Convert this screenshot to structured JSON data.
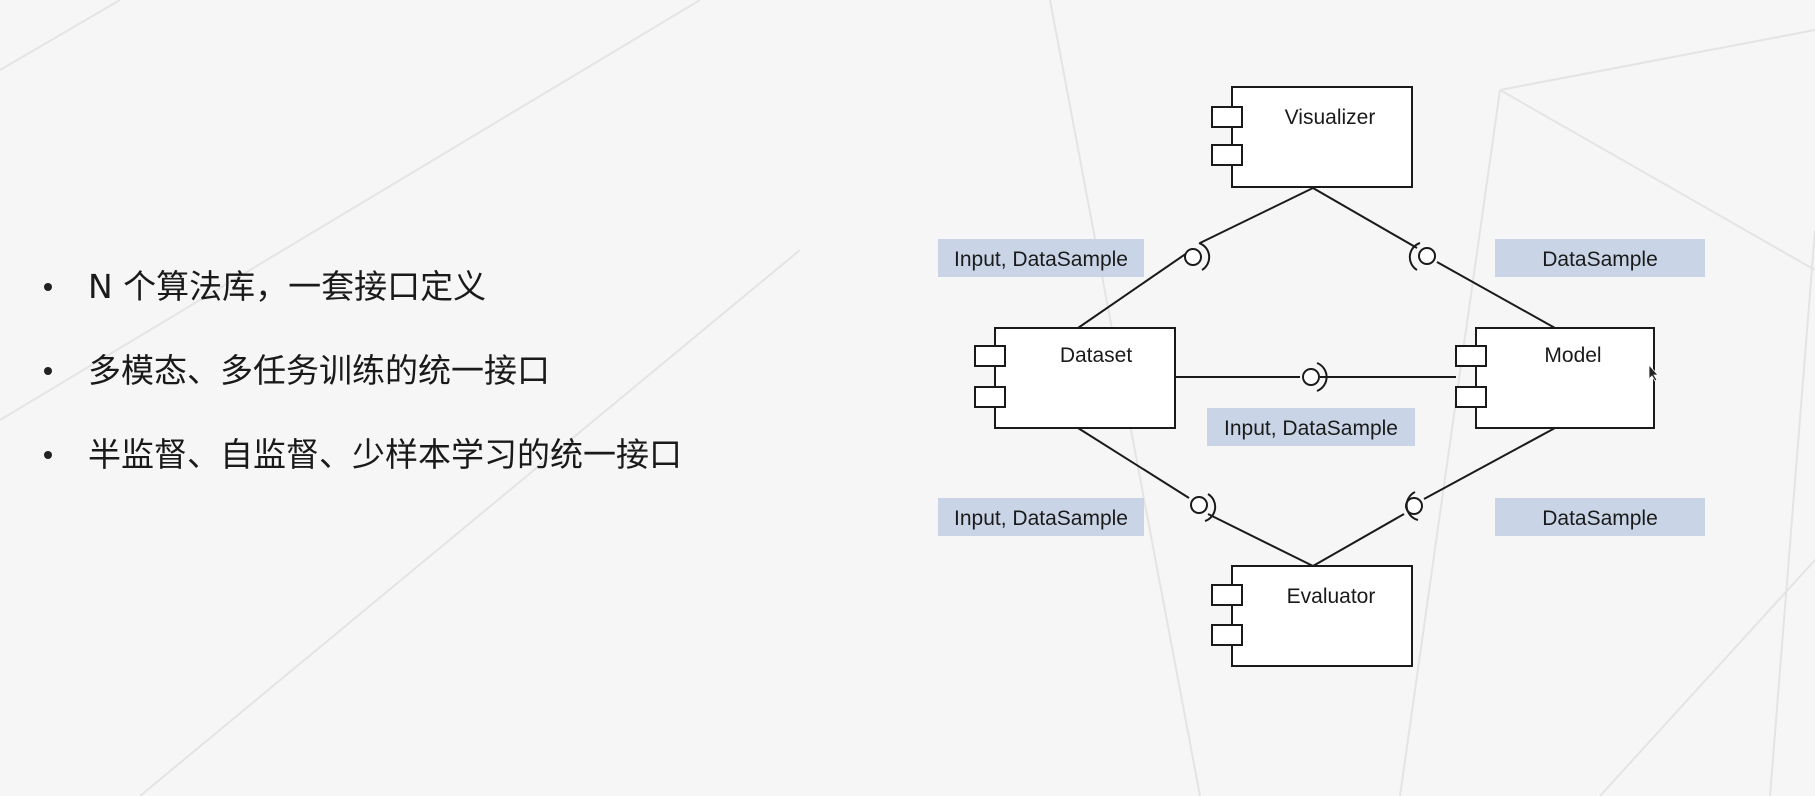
{
  "bullets": [
    "N 个算法库，一套接口定义",
    "多模态、多任务训练的统一接口",
    "半监督、自监督、少样本学习的统一接口"
  ],
  "components": {
    "visualizer": "Visualizer",
    "dataset": "Dataset",
    "model": "Model",
    "evaluator": "Evaluator"
  },
  "interface_labels": {
    "dataset_to_visualizer": "Input, DataSample",
    "model_to_visualizer": "DataSample",
    "dataset_to_model": "Input, DataSample",
    "dataset_to_evaluator": "Input, DataSample",
    "model_to_evaluator": "DataSample"
  },
  "colors": {
    "label_bg": "#c9d5e6",
    "line": "#1a1a1a",
    "box_fill": "#ffffff"
  }
}
